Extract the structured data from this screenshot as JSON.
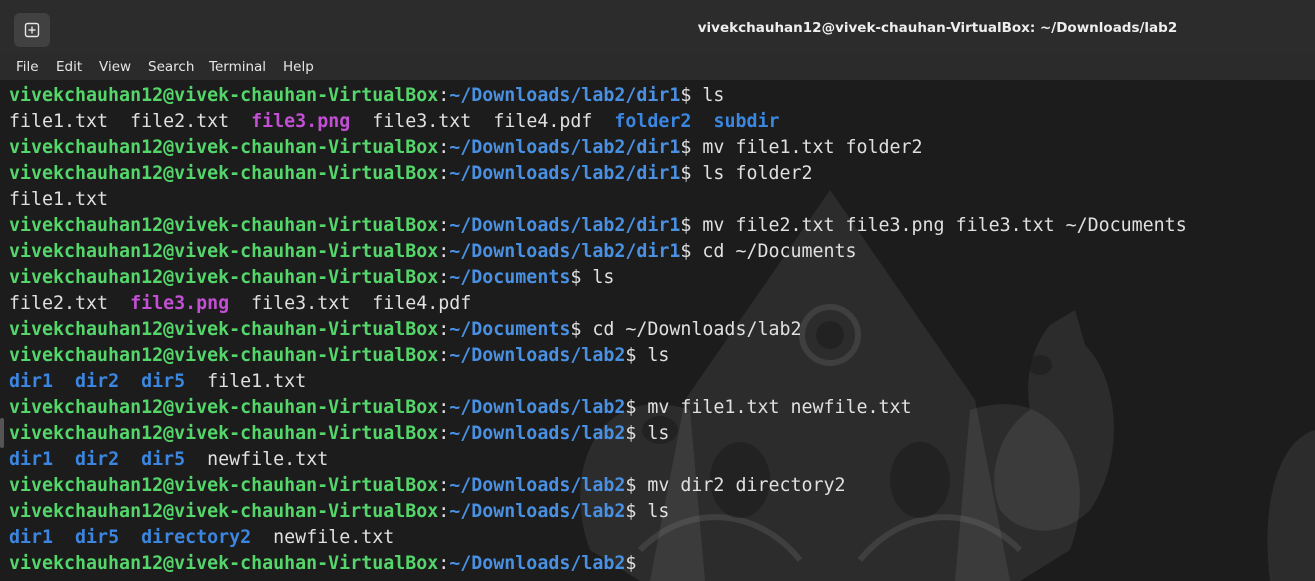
{
  "window": {
    "title": "vivekchauhan12@vivek-chauhan-VirtualBox: ~/Downloads/lab2"
  },
  "menu": [
    "File",
    "Edit",
    "View",
    "Search",
    "Terminal",
    "Help"
  ],
  "icons": {
    "new_tab": "new-tab-icon"
  },
  "colors": {
    "prompt_user": "#54d66a",
    "prompt_path": "#4a90e2",
    "directory": "#3a86e0",
    "image_file": "#c24fd4",
    "text": "#e0e0e0",
    "background": "#1c1c1c"
  },
  "terminal": {
    "lines": [
      {
        "type": "prompt",
        "user": "vivekchauhan12@vivek-chauhan-VirtualBox",
        "path": "~/Downloads/lab2/dir1",
        "command": "ls"
      },
      {
        "type": "output",
        "tokens": [
          {
            "text": "file1.txt",
            "kind": "file"
          },
          {
            "text": "file2.txt",
            "kind": "file"
          },
          {
            "text": "file3.png",
            "kind": "image"
          },
          {
            "text": "file3.txt",
            "kind": "file"
          },
          {
            "text": "file4.pdf",
            "kind": "file"
          },
          {
            "text": "folder2",
            "kind": "dir"
          },
          {
            "text": "subdir",
            "kind": "dir"
          }
        ]
      },
      {
        "type": "prompt",
        "user": "vivekchauhan12@vivek-chauhan-VirtualBox",
        "path": "~/Downloads/lab2/dir1",
        "command": "mv file1.txt folder2"
      },
      {
        "type": "prompt",
        "user": "vivekchauhan12@vivek-chauhan-VirtualBox",
        "path": "~/Downloads/lab2/dir1",
        "command": "ls folder2"
      },
      {
        "type": "output",
        "tokens": [
          {
            "text": "file1.txt",
            "kind": "file"
          }
        ]
      },
      {
        "type": "prompt",
        "user": "vivekchauhan12@vivek-chauhan-VirtualBox",
        "path": "~/Downloads/lab2/dir1",
        "command": "mv file2.txt file3.png file3.txt ~/Documents"
      },
      {
        "type": "prompt",
        "user": "vivekchauhan12@vivek-chauhan-VirtualBox",
        "path": "~/Downloads/lab2/dir1",
        "command": "cd ~/Documents"
      },
      {
        "type": "prompt",
        "user": "vivekchauhan12@vivek-chauhan-VirtualBox",
        "path": "~/Documents",
        "command": "ls"
      },
      {
        "type": "output",
        "tokens": [
          {
            "text": "file2.txt",
            "kind": "file"
          },
          {
            "text": "file3.png",
            "kind": "image"
          },
          {
            "text": "file3.txt",
            "kind": "file"
          },
          {
            "text": "file4.pdf",
            "kind": "file"
          }
        ]
      },
      {
        "type": "prompt",
        "user": "vivekchauhan12@vivek-chauhan-VirtualBox",
        "path": "~/Documents",
        "command": "cd ~/Downloads/lab2"
      },
      {
        "type": "prompt",
        "user": "vivekchauhan12@vivek-chauhan-VirtualBox",
        "path": "~/Downloads/lab2",
        "command": "ls"
      },
      {
        "type": "output",
        "tokens": [
          {
            "text": "dir1",
            "kind": "dir"
          },
          {
            "text": "dir2",
            "kind": "dir"
          },
          {
            "text": "dir5",
            "kind": "dir"
          },
          {
            "text": "file1.txt",
            "kind": "file"
          }
        ]
      },
      {
        "type": "prompt",
        "user": "vivekchauhan12@vivek-chauhan-VirtualBox",
        "path": "~/Downloads/lab2",
        "command": "mv file1.txt newfile.txt"
      },
      {
        "type": "prompt",
        "user": "vivekchauhan12@vivek-chauhan-VirtualBox",
        "path": "~/Downloads/lab2",
        "command": "ls"
      },
      {
        "type": "output",
        "tokens": [
          {
            "text": "dir1",
            "kind": "dir"
          },
          {
            "text": "dir2",
            "kind": "dir"
          },
          {
            "text": "dir5",
            "kind": "dir"
          },
          {
            "text": "newfile.txt",
            "kind": "file"
          }
        ]
      },
      {
        "type": "prompt",
        "user": "vivekchauhan12@vivek-chauhan-VirtualBox",
        "path": "~/Downloads/lab2",
        "command": "mv dir2 directory2"
      },
      {
        "type": "prompt",
        "user": "vivekchauhan12@vivek-chauhan-VirtualBox",
        "path": "~/Downloads/lab2",
        "command": "ls"
      },
      {
        "type": "output",
        "tokens": [
          {
            "text": "dir1",
            "kind": "dir"
          },
          {
            "text": "dir5",
            "kind": "dir"
          },
          {
            "text": "directory2",
            "kind": "dir"
          },
          {
            "text": "newfile.txt",
            "kind": "file"
          }
        ]
      },
      {
        "type": "prompt",
        "user": "vivekchauhan12@vivek-chauhan-VirtualBox",
        "path": "~/Downloads/lab2",
        "command": ""
      }
    ]
  }
}
